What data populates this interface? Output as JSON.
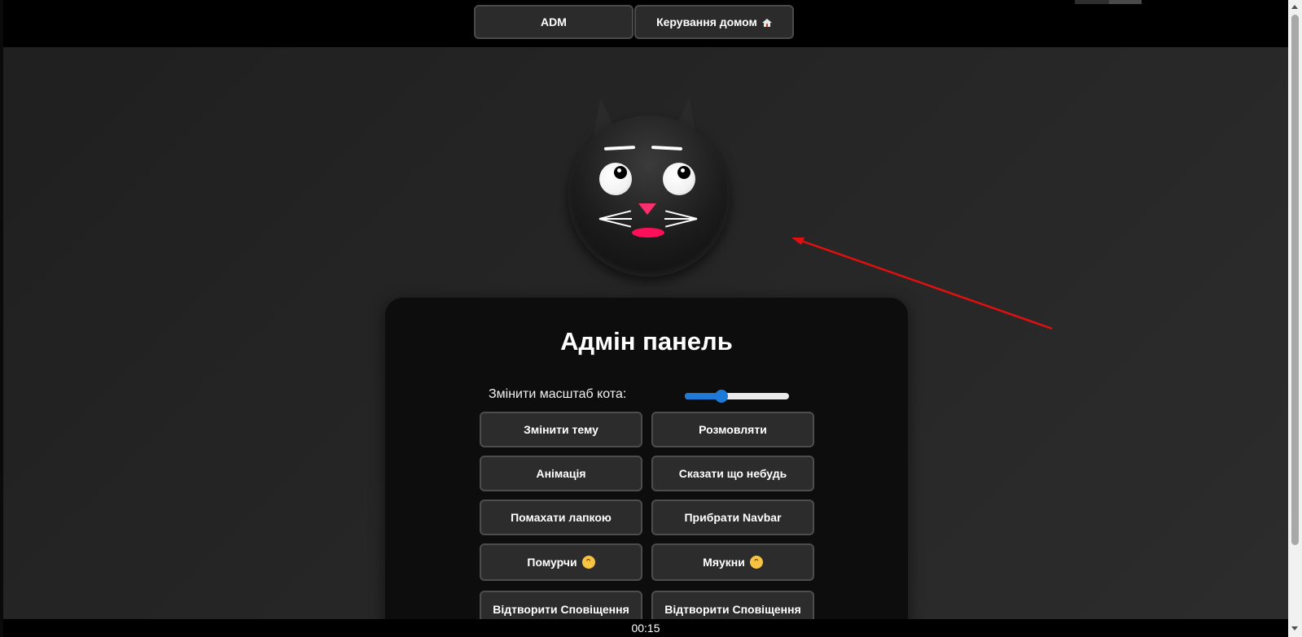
{
  "navbar": {
    "adm_label": "ADM",
    "home_label": "Керування домом",
    "home_icon": "house-icon"
  },
  "cat": {
    "eye_color": "#ffffff",
    "nose_color": "#ff2f6e",
    "mouth_color": "#ff0f5a"
  },
  "panel": {
    "title": "Адмін панель",
    "scale_label": "Змінити масштаб кота:",
    "scale_value": 0.35,
    "slider_color": "#1e7ad6",
    "buttons": [
      {
        "label": "Змінити тему"
      },
      {
        "label": "Розмовляти"
      },
      {
        "label": "Анімація"
      },
      {
        "label": "Сказати що небудь"
      },
      {
        "label": "Помахати лапкою"
      },
      {
        "label": "Прибрати Navbar"
      },
      {
        "label": "Помурчи",
        "icon": "grinning-cat-icon"
      },
      {
        "label": "Мяукни",
        "icon": "grinning-cat-icon"
      },
      {
        "label": "Відтворити Сповіщення"
      },
      {
        "label": "Відтворити Сповіщення"
      }
    ]
  },
  "timer": {
    "value": "00:15"
  },
  "annotation": {
    "arrow_color": "#e01010"
  }
}
